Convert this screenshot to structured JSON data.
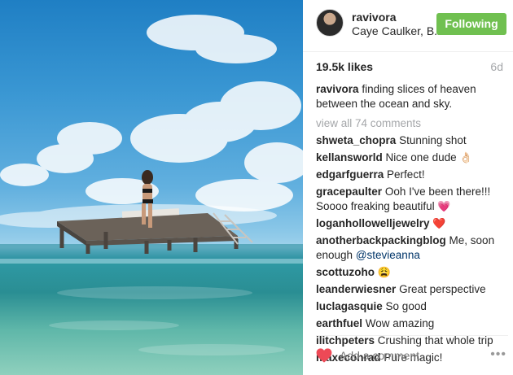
{
  "post": {
    "username": "ravivora",
    "location": "Caye Caulker, B...",
    "follow_label": "Following",
    "likes": "19.5k likes",
    "time_ago": "6d",
    "caption_user": "ravivora",
    "caption_text": "finding slices of heaven between the ocean and sky.",
    "view_all": "view all 74 comments",
    "add_comment_placeholder": "Add a comment...",
    "more_label": "•••"
  },
  "comments": [
    {
      "user": "shweta_chopra",
      "text": "Stunning shot"
    },
    {
      "user": "kellansworld",
      "text": "Nice one dude",
      "emoji": "👌🏻"
    },
    {
      "user": "edgarfguerra",
      "text": "Perfect!"
    },
    {
      "user": "gracepaulter",
      "text": "Ooh I've been there!!! Soooo freaking beautiful",
      "emoji": "💗"
    },
    {
      "user": "loganhollowelljewelry",
      "text": "",
      "emoji": "❤️"
    },
    {
      "user": "anotherbackpackingblog",
      "text": "Me, soon enough",
      "mention": "@stevieanna"
    },
    {
      "user": "scottuzoho",
      "text": "",
      "emoji": "😩"
    },
    {
      "user": "leanderwiesner",
      "text": "Great perspective"
    },
    {
      "user": "luclagasquie",
      "text": "So good"
    },
    {
      "user": "earthfuel",
      "text": "Wow amazing"
    },
    {
      "user": "ilitchpeters",
      "text": "Crushing that whole trip"
    },
    {
      "user": "maxeconrad",
      "text": "Pure magic!"
    }
  ],
  "colors": {
    "follow_bg": "#70c050",
    "heart": "#ed4956",
    "muted": "#a5a7aa"
  },
  "icons": {
    "heart": "heart-icon",
    "more": "more-options-icon"
  }
}
